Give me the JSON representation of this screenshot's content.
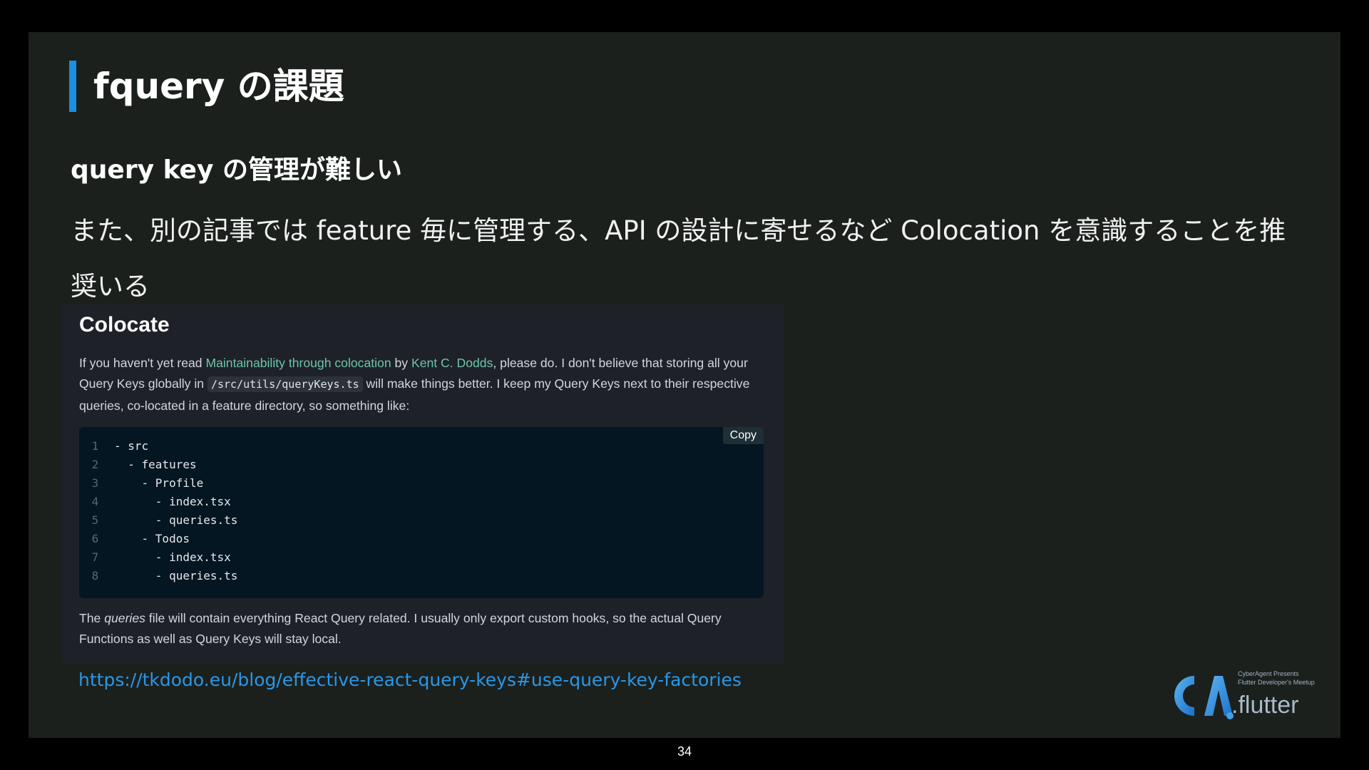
{
  "slide": {
    "title": "fquery の課題",
    "subtitle": "query key の管理が難しい",
    "body": "また、別の記事では feature 毎に管理する、API の設計に寄せるなど Colocation を意識することを推奨いる",
    "accent_color": "#1a8fe3"
  },
  "article": {
    "heading": "Colocate",
    "p1": {
      "t1": "If you haven't yet read ",
      "link1": "Maintainability through colocation",
      "t2": " by ",
      "link2": "Kent C. Dodds",
      "t3": ", please do. I don't believe that storing all your Query Keys globally in ",
      "code": "/src/utils/queryKeys.ts",
      "t4": " will make things better. I keep my Query Keys next to their respective queries, co-located in a feature directory, so something like:"
    },
    "code_block": {
      "copy_label": "Copy",
      "lines": [
        {
          "num": "1",
          "text": "- src"
        },
        {
          "num": "2",
          "text": "  - features"
        },
        {
          "num": "3",
          "text": "    - Profile"
        },
        {
          "num": "4",
          "text": "      - index.tsx"
        },
        {
          "num": "5",
          "text": "      - queries.ts"
        },
        {
          "num": "6",
          "text": "    - Todos"
        },
        {
          "num": "7",
          "text": "      - index.tsx"
        },
        {
          "num": "8",
          "text": "      - queries.ts"
        }
      ]
    },
    "p2": {
      "t1": "The ",
      "em": "queries",
      "t2": " file will contain everything React Query related. I usually only export custom hooks, so the actual Query Functions as well as Query Keys will stay local."
    }
  },
  "url": "https://tkdodo.eu/blog/effective-react-query-keys#use-query-key-factories",
  "logo": {
    "line1": "CyberAgent Presents",
    "line2": "Flutter Developer's Meetup",
    "wordmark": ".flutter",
    "icon": "ca-logo-icon"
  },
  "page_number": "34"
}
